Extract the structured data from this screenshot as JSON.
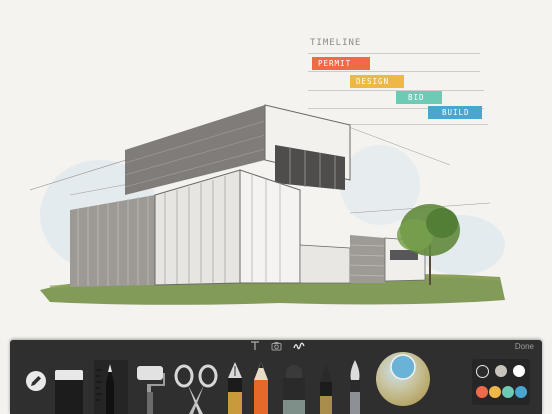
{
  "timeline": {
    "title": "TIMELINE",
    "bars": [
      {
        "label": "PERMIT",
        "color": "#ef6a4b"
      },
      {
        "label": "DESIGN",
        "color": "#efb746"
      },
      {
        "label": "BID",
        "color": "#6ccab5"
      },
      {
        "label": "BUILD",
        "color": "#4aa6cf"
      }
    ]
  },
  "toolbar": {
    "mode_icons": [
      "text-icon",
      "camera-icon",
      "draw-icon"
    ],
    "done_label": "Done",
    "tools": [
      "pencil-edit",
      "eraser",
      "ruler",
      "roller",
      "scissors",
      "fountain-pen",
      "pencil",
      "marker",
      "pen",
      "brush"
    ],
    "color_wheel_color": "#6bb3d6",
    "palette_colors": [
      "#2c2c2c",
      "#c9c3bc",
      "#ffffff",
      "#ef6a4b",
      "#efb746",
      "#6ccab5",
      "#4aa6cf"
    ]
  }
}
